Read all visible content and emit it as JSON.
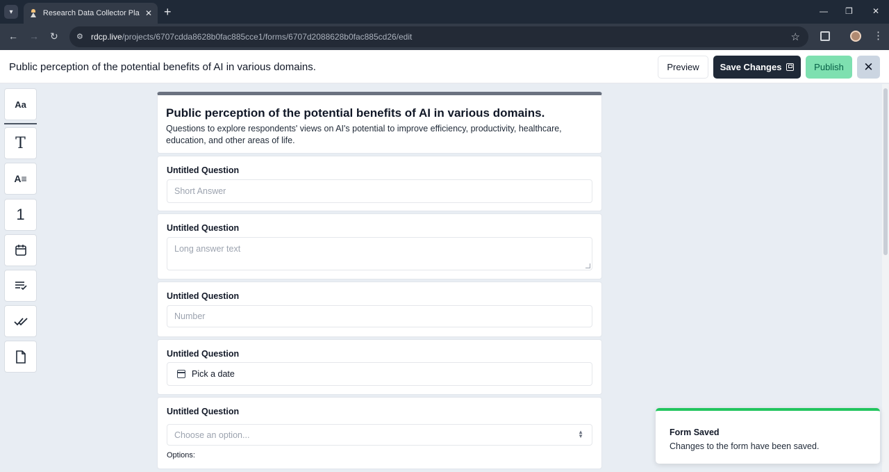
{
  "browser": {
    "tab_title": "Research Data Collector Platform",
    "url_host": "rdcp.live",
    "url_path": "/projects/6707cdda8628b0fac885cce1/forms/6707d2088628b0fac885cd26/edit",
    "new_tab": "+",
    "tab_close": "✕",
    "minimize": "—",
    "maximize": "❐",
    "close": "✕"
  },
  "header": {
    "title": "Public perception of the potential benefits of AI in various domains.",
    "preview_label": "Preview",
    "save_label": "Save Changes",
    "publish_label": "Publish",
    "close_label": "✕"
  },
  "toolbox": {
    "items": [
      {
        "icon": "text-style-icon",
        "glyph": "Aa"
      },
      {
        "icon": "text-icon",
        "glyph": "T"
      },
      {
        "icon": "paragraph-icon",
        "glyph": "A≡"
      },
      {
        "icon": "number-icon",
        "glyph": "1"
      },
      {
        "icon": "calendar-icon",
        "glyph": "📅"
      },
      {
        "icon": "list-check-icon",
        "glyph": "≡✓"
      },
      {
        "icon": "double-check-icon",
        "glyph": "✓✓"
      },
      {
        "icon": "file-icon",
        "glyph": "🗋"
      }
    ]
  },
  "form": {
    "title": "Public perception of the potential benefits of AI in various domains.",
    "description": "Questions to explore respondents' views on AI's potential to improve efficiency, productivity, healthcare, education, and other areas of life.",
    "questions": [
      {
        "label": "Untitled Question",
        "placeholder": "Short Answer"
      },
      {
        "label": "Untitled Question",
        "placeholder": "Long answer text"
      },
      {
        "label": "Untitled Question",
        "placeholder": "Number"
      },
      {
        "label": "Untitled Question",
        "value": "Pick a date"
      },
      {
        "label": "Untitled Question",
        "placeholder": "Choose an option...",
        "options_label": "Options:"
      }
    ]
  },
  "toast": {
    "title": "Form Saved",
    "message": "Changes to the form have been saved."
  },
  "colors": {
    "accent_dark": "#1f2937",
    "publish": "#7ee0b0",
    "success": "#22c55e"
  }
}
